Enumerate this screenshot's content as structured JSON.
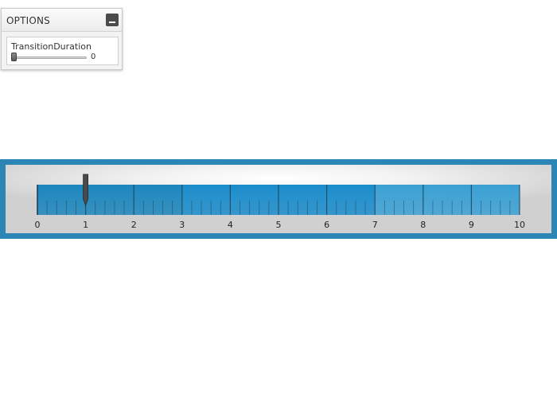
{
  "options": {
    "title": "OPTIONS",
    "collapse_icon": "minimize-icon",
    "transition_duration": {
      "label": "TransitionDuration",
      "value": "0",
      "slider_fraction": 0
    }
  },
  "gauge": {
    "min": 0,
    "max": 10,
    "major_tick_labels": [
      "0",
      "1",
      "2",
      "3",
      "4",
      "5",
      "6",
      "7",
      "8",
      "9",
      "10"
    ],
    "minor_ticks_per_major": 5,
    "pointer_value": 1,
    "ranges": [
      {
        "from": 0,
        "to": 3,
        "color": "#1c86bd"
      },
      {
        "from": 3,
        "to": 7,
        "color": "#1a8ccb"
      },
      {
        "from": 7,
        "to": 10,
        "color": "#3aa0d4"
      }
    ],
    "frame_color": "#2b86b5",
    "pointer_color": "#4a4a4a",
    "tick_color": "#1c3f55"
  }
}
